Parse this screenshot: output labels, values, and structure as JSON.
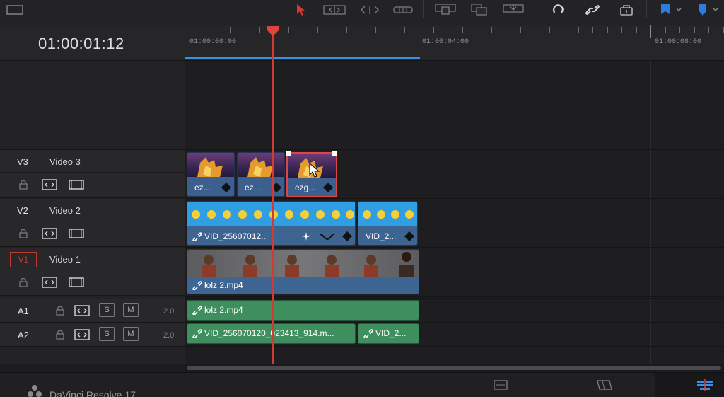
{
  "app": {
    "name": "DaVinci Resolve 17"
  },
  "timecode": "01:00:01:12",
  "ruler": {
    "labels": [
      "01:00:00:00",
      "01:00:04:00",
      "01:00:08:00"
    ]
  },
  "tracks": {
    "v3": {
      "id": "V3",
      "name": "Video 3"
    },
    "v2": {
      "id": "V2",
      "name": "Video 2"
    },
    "v1": {
      "id": "V1",
      "name": "Video 1"
    },
    "a1": {
      "id": "A1",
      "solo": "S",
      "mute": "M",
      "channels": "2.0"
    },
    "a2": {
      "id": "A2",
      "solo": "S",
      "mute": "M",
      "channels": "2.0"
    }
  },
  "clips": {
    "v3": [
      "ez...",
      "ez...",
      "ezg..."
    ],
    "v2": [
      "VID_25607012...",
      "VID_2..."
    ],
    "v1": "lolz 2.mp4",
    "a1": "lolz 2.mp4",
    "a2": [
      "VID_256070120_023413_914.m...",
      "VID_2..."
    ]
  },
  "colors": {
    "accent_red": "#d23b31",
    "video_clip": "#3e6492",
    "audio_clip": "#3f8f5e",
    "inout_blue": "#3a8ee6"
  }
}
